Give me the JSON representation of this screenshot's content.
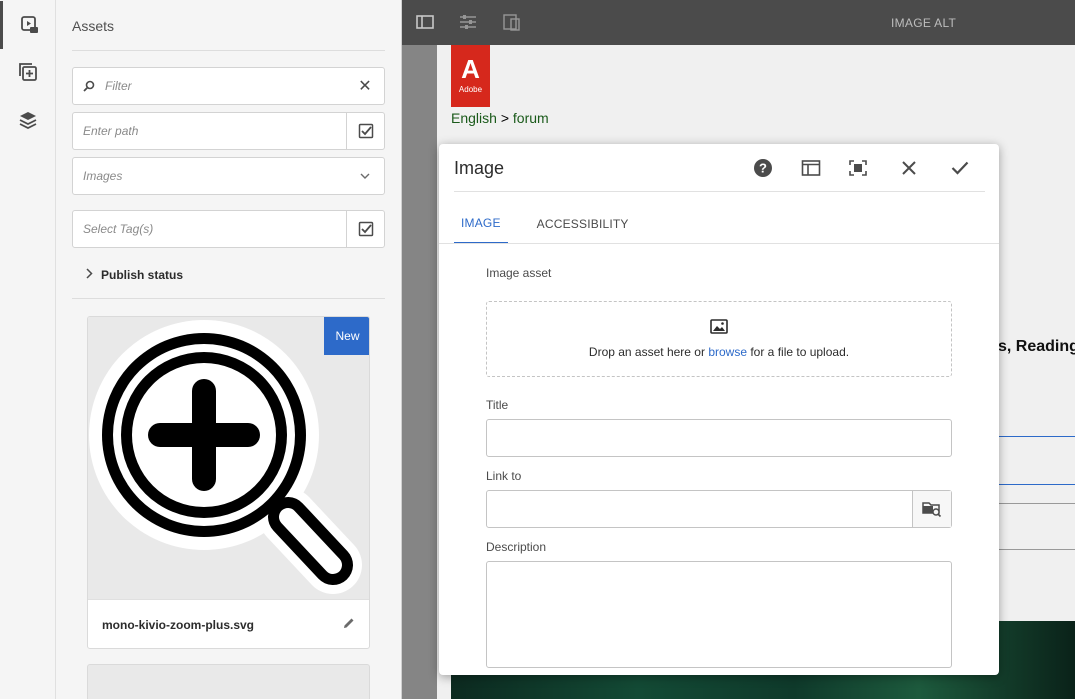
{
  "rail": {
    "items": [
      {
        "name": "assets-finder-icon"
      },
      {
        "name": "components-icon"
      },
      {
        "name": "content-tree-icon"
      }
    ]
  },
  "panel": {
    "title": "Assets",
    "filter_placeholder": "Filter",
    "path_placeholder": "Enter path",
    "type_select": "Images",
    "tags_placeholder": "Select Tag(s)",
    "publish_status": "Publish status",
    "card": {
      "badge": "New",
      "filename": "mono-kivio-zoom-plus.svg"
    }
  },
  "topbar": {
    "title": "IMAGE ALT"
  },
  "page": {
    "logo_letter": "A",
    "logo_word": "Adobe",
    "crumb_1": "English",
    "crumb_sep": ">",
    "crumb_2": "forum",
    "partial_text": "s, Reading"
  },
  "dialog": {
    "title": "Image",
    "tabs": [
      {
        "label": "IMAGE",
        "active": true
      },
      {
        "label": "ACCESSIBILITY",
        "active": false
      }
    ],
    "image_asset_label": "Image asset",
    "drop_text_before": "Drop an asset here or",
    "drop_link": "browse",
    "drop_text_after": "for a file to upload.",
    "title_label": "Title",
    "title_value": "",
    "link_label": "Link to",
    "link_value": "",
    "description_label": "Description",
    "description_value": ""
  },
  "colors": {
    "accent": "#2d6ac9",
    "topbar": "#4b4b4b",
    "adobe_red": "#d6281c"
  }
}
